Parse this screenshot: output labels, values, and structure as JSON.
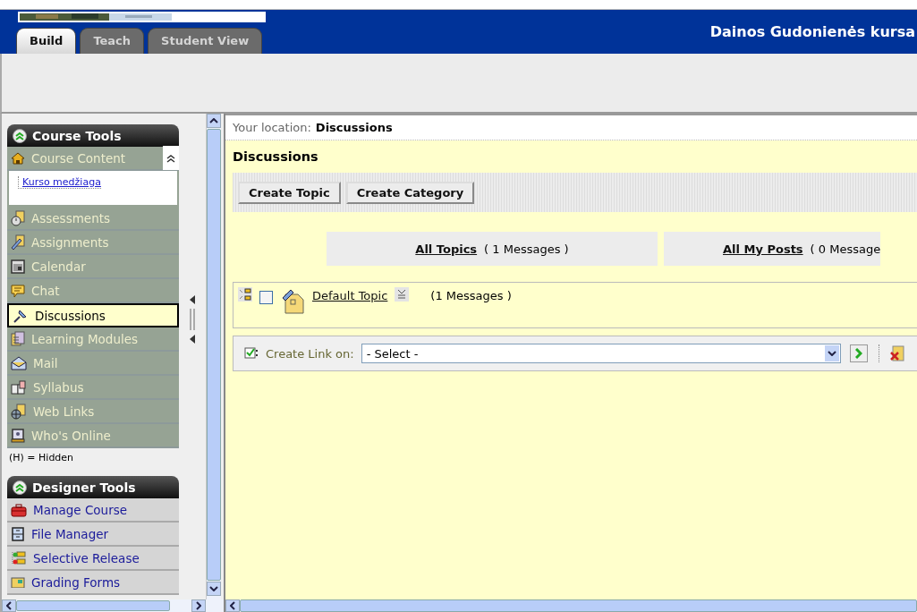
{
  "header": {
    "title": "Dainos Gudonienės kursa",
    "tabs": [
      {
        "label": "Build",
        "selected": true
      },
      {
        "label": "Teach",
        "selected": false
      },
      {
        "label": "Student View",
        "selected": false
      }
    ]
  },
  "sidebar": {
    "sections": [
      {
        "kind": "tools",
        "title": "Course Tools",
        "expanded": true,
        "note": "(H) = Hidden",
        "items": [
          {
            "label": "Course Content",
            "selected": false,
            "expanded": true,
            "children": [
              {
                "label": "Kurso medžiaga"
              }
            ]
          },
          {
            "label": "Assessments",
            "selected": false
          },
          {
            "label": "Assignments",
            "selected": false
          },
          {
            "label": "Calendar",
            "selected": false
          },
          {
            "label": "Chat",
            "selected": false
          },
          {
            "label": "Discussions",
            "selected": true
          },
          {
            "label": "Learning Modules",
            "selected": false
          },
          {
            "label": "Mail",
            "selected": false
          },
          {
            "label": "Syllabus",
            "selected": false
          },
          {
            "label": "Web Links",
            "selected": false
          },
          {
            "label": "Who's Online",
            "selected": false
          }
        ]
      },
      {
        "kind": "designer",
        "title": "Designer Tools",
        "expanded": true,
        "items": [
          {
            "label": "Manage Course",
            "selected": false
          },
          {
            "label": "File Manager",
            "selected": false
          },
          {
            "label": "Selective Release",
            "selected": false
          },
          {
            "label": "Grading Forms",
            "selected": false
          }
        ]
      }
    ]
  },
  "content": {
    "location_label": "Your location:",
    "location": "Discussions",
    "heading": "Discussions",
    "buttons": [
      "Create Topic",
      "Create Category"
    ],
    "filters": [
      {
        "link": "All Topics",
        "count": "( 1 Messages )"
      },
      {
        "link": "All My Posts",
        "count": "( 0 Message"
      }
    ],
    "topics": [
      {
        "title": "Default Topic",
        "count": "(1 Messages )",
        "checked": false
      }
    ],
    "create_link": {
      "label": "Create Link on:",
      "value": "- Select -"
    }
  }
}
